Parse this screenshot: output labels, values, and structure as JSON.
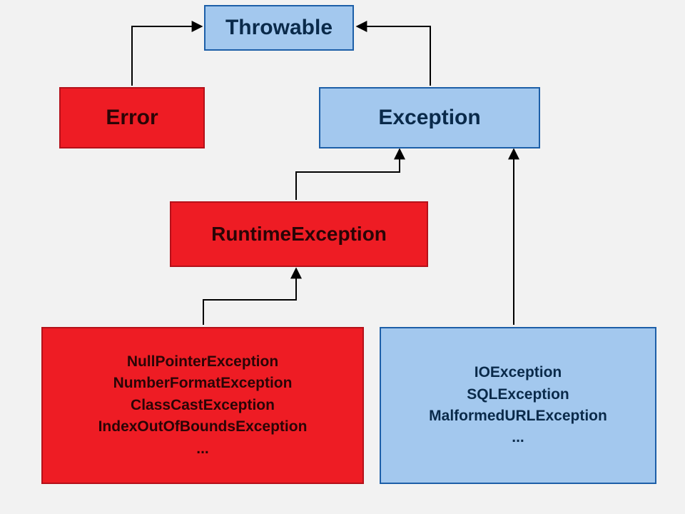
{
  "chart_data": {
    "type": "hierarchy-diagram",
    "nodes": [
      {
        "id": "throwable",
        "label": "Throwable",
        "kind": "base"
      },
      {
        "id": "error",
        "label": "Error",
        "kind": "unchecked"
      },
      {
        "id": "exception",
        "label": "Exception",
        "kind": "checked"
      },
      {
        "id": "runtime",
        "label": "RuntimeException",
        "kind": "unchecked"
      },
      {
        "id": "runtime_examples",
        "label_list": [
          "NullPointerException",
          "NumberFormatException",
          "ClassCastException",
          "IndexOutOfBoundsException",
          "..."
        ],
        "kind": "unchecked"
      },
      {
        "id": "checked_examples",
        "label_list": [
          "IOException",
          "SQLException",
          "MalformedURLException",
          "..."
        ],
        "kind": "checked"
      }
    ],
    "edges": [
      {
        "from": "error",
        "to": "throwable"
      },
      {
        "from": "exception",
        "to": "throwable"
      },
      {
        "from": "runtime",
        "to": "exception"
      },
      {
        "from": "checked_examples",
        "to": "exception"
      },
      {
        "from": "runtime_examples",
        "to": "runtime"
      }
    ],
    "color_legend": {
      "unchecked": "#ee1c24",
      "checked_or_base": "#a3c8ee"
    }
  },
  "labels": {
    "throwable": "Throwable",
    "error": "Error",
    "exception": "Exception",
    "runtime": "RuntimeException",
    "rt1": "NullPointerException",
    "rt2": "NumberFormatException",
    "rt3": "ClassCastException",
    "rt4": "IndexOutOfBoundsException",
    "rt5": "...",
    "ck1": "IOException",
    "ck2": "SQLException",
    "ck3": "MalformedURLException",
    "ck4": "..."
  }
}
